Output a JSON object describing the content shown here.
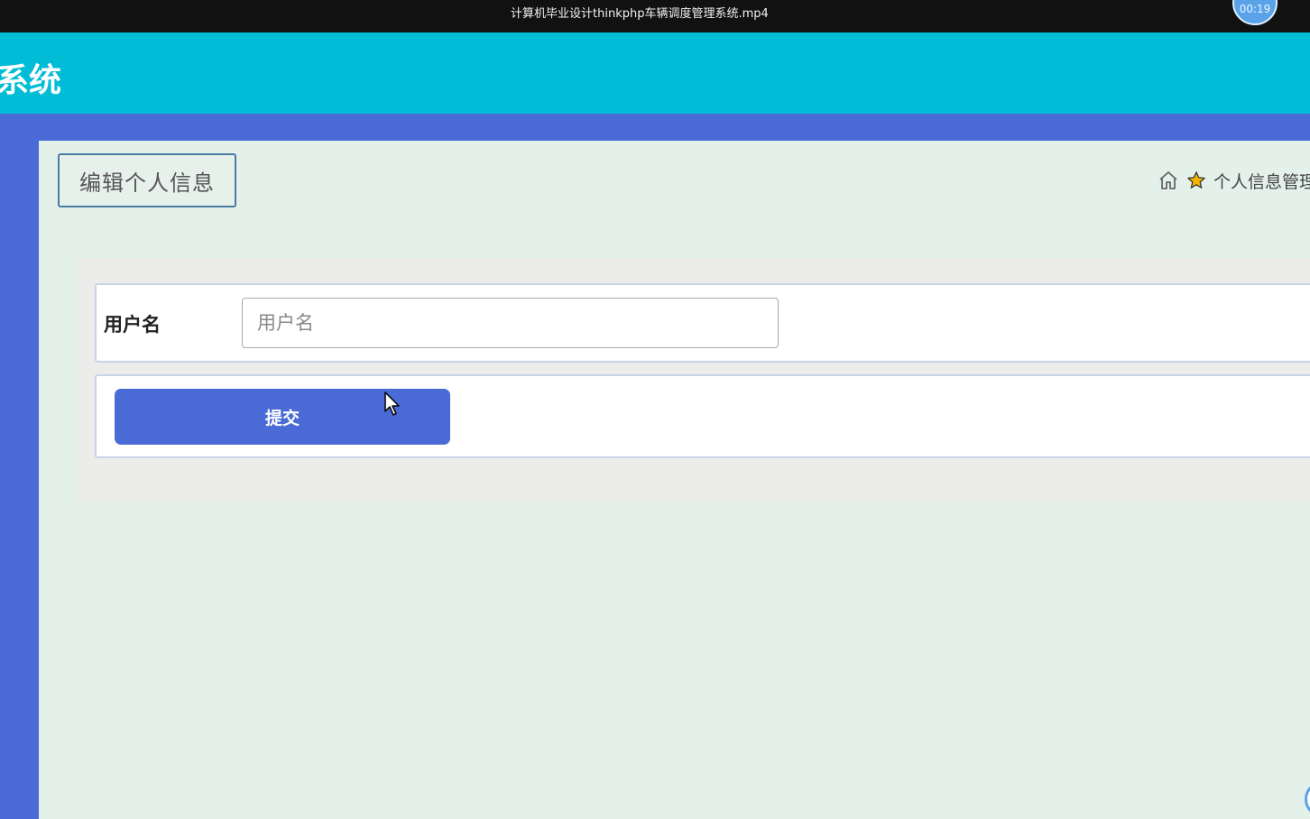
{
  "video": {
    "title": "计算机毕业设计thinkphp车辆调度管理系统.mp4",
    "timer": "00:19"
  },
  "header": {
    "brand": "系统"
  },
  "page": {
    "title": "编辑个人信息",
    "breadcrumb": "个人信息管理"
  },
  "form": {
    "username_label": "用户名",
    "username_placeholder": "用户名",
    "username_value": "",
    "submit_label": "提交"
  },
  "icons": {
    "home": "home-icon",
    "star": "star-icon",
    "star_color": "#f5b301"
  },
  "colors": {
    "header": "#00bcd6",
    "accent": "#4a6bd6",
    "content_bg": "#e4f1eb"
  }
}
